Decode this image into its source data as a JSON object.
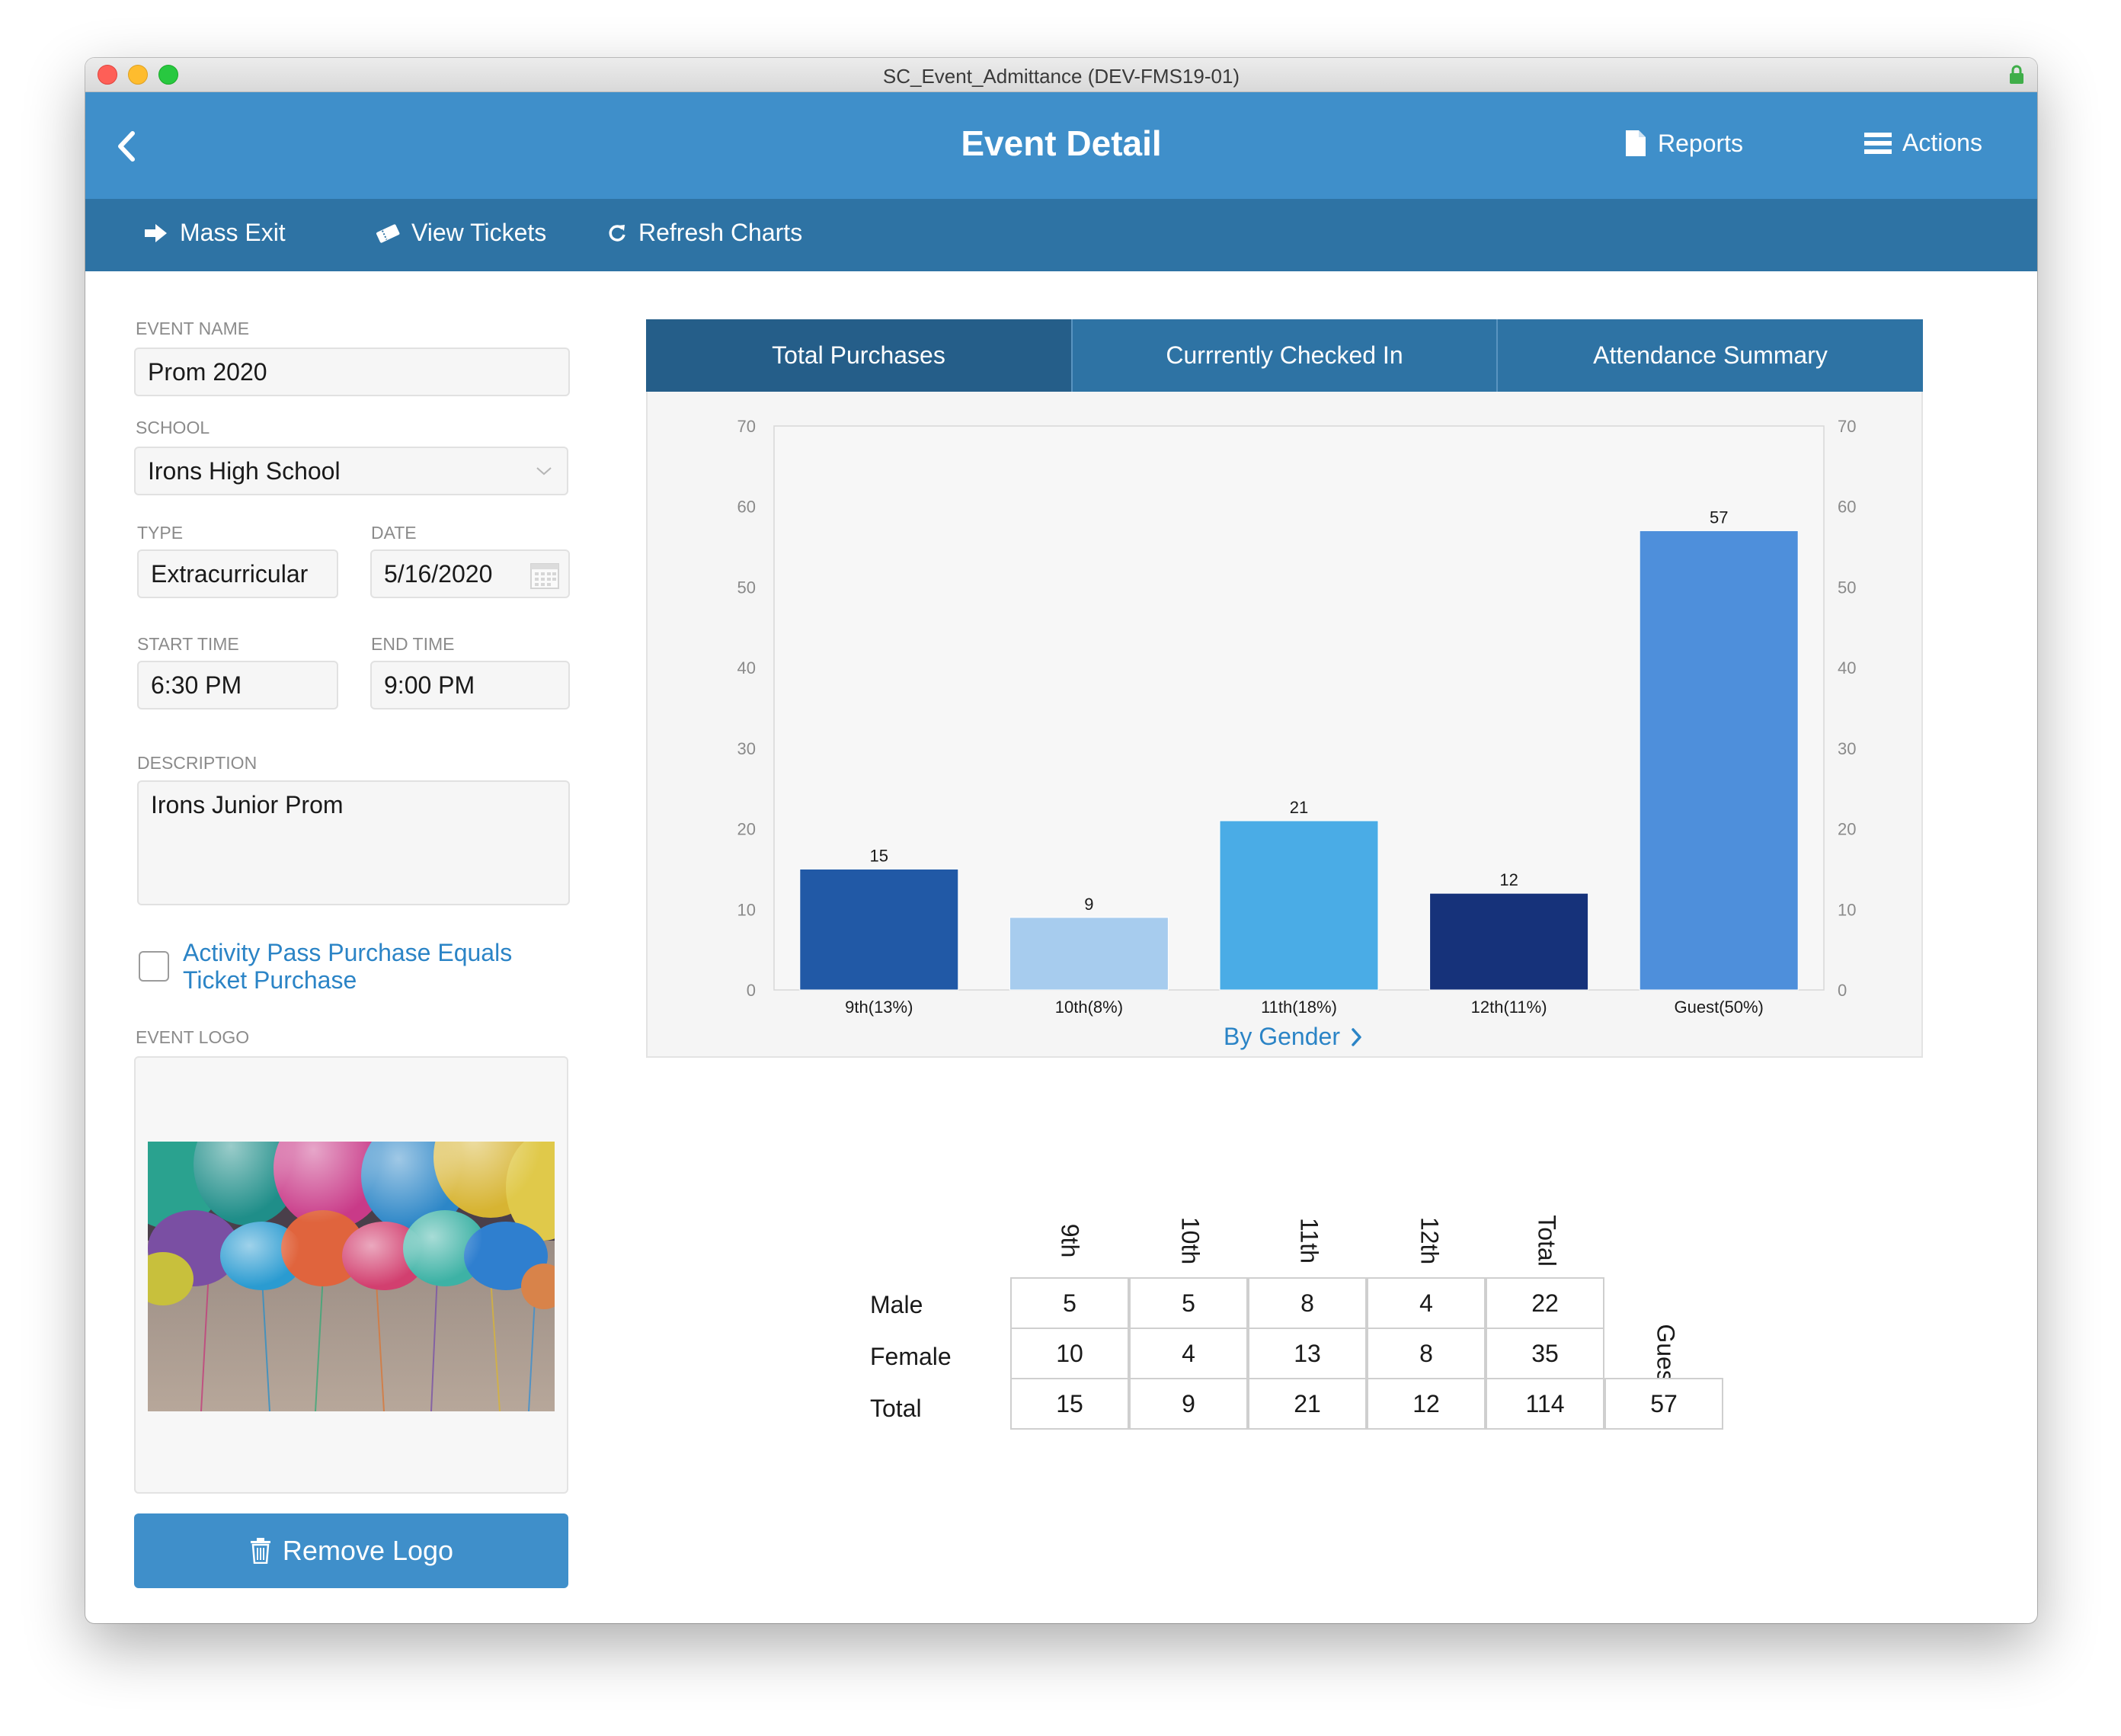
{
  "window": {
    "title": "SC_Event_Admittance (DEV-FMS19-01)"
  },
  "header": {
    "title": "Event Detail",
    "reports_label": "Reports",
    "actions_label": "Actions"
  },
  "toolbar": {
    "mass_exit": "Mass Exit",
    "view_tickets": "View Tickets",
    "refresh_charts": "Refresh Charts"
  },
  "form": {
    "event_name": {
      "label": "EVENT NAME",
      "value": "Prom 2020"
    },
    "school": {
      "label": "SCHOOL",
      "value": "Irons High School"
    },
    "type": {
      "label": "TYPE",
      "value": "Extracurricular"
    },
    "date": {
      "label": "DATE",
      "value": "5/16/2020"
    },
    "start_time": {
      "label": "START TIME",
      "value": "6:30 PM"
    },
    "end_time": {
      "label": "END TIME",
      "value": "9:00 PM"
    },
    "description": {
      "label": "DESCRIPTION",
      "value": "Irons Junior Prom"
    },
    "activity_pass": {
      "label": "Activity Pass Purchase Equals Ticket Purchase",
      "checked": false
    },
    "event_logo": {
      "label": "EVENT LOGO"
    },
    "remove_logo": "Remove Logo"
  },
  "tabs": [
    {
      "label": "Total Purchases",
      "active": true
    },
    {
      "label": "Currrently Checked In",
      "active": false
    },
    {
      "label": "Attendance Summary",
      "active": false
    }
  ],
  "chart_data": {
    "type": "bar",
    "categories": [
      "9th(13%)",
      "10th(8%)",
      "11th(18%)",
      "12th(11%)",
      "Guest(50%)"
    ],
    "values": [
      15,
      9,
      21,
      12,
      57
    ],
    "colors": [
      "#2159a6",
      "#a7ccee",
      "#4aace6",
      "#16327a",
      "#4e8fdb"
    ],
    "ylim": [
      0,
      70
    ],
    "yticks": [
      0,
      10,
      20,
      30,
      40,
      50,
      60,
      70
    ],
    "y_axis_right": true,
    "grid": false,
    "legend": "none"
  },
  "by_gender": {
    "label": "By Gender"
  },
  "gender_table": {
    "columns": [
      "9th",
      "10th",
      "11th",
      "12th",
      "Total"
    ],
    "guests_label": "Guests",
    "rows": [
      {
        "label": "Male",
        "values": [
          "5",
          "5",
          "8",
          "4",
          "22"
        ]
      },
      {
        "label": "Female",
        "values": [
          "10",
          "4",
          "13",
          "8",
          "35"
        ]
      },
      {
        "label": "Total",
        "values": [
          "15",
          "9",
          "21",
          "12",
          "114"
        ],
        "guests": "57"
      }
    ]
  }
}
